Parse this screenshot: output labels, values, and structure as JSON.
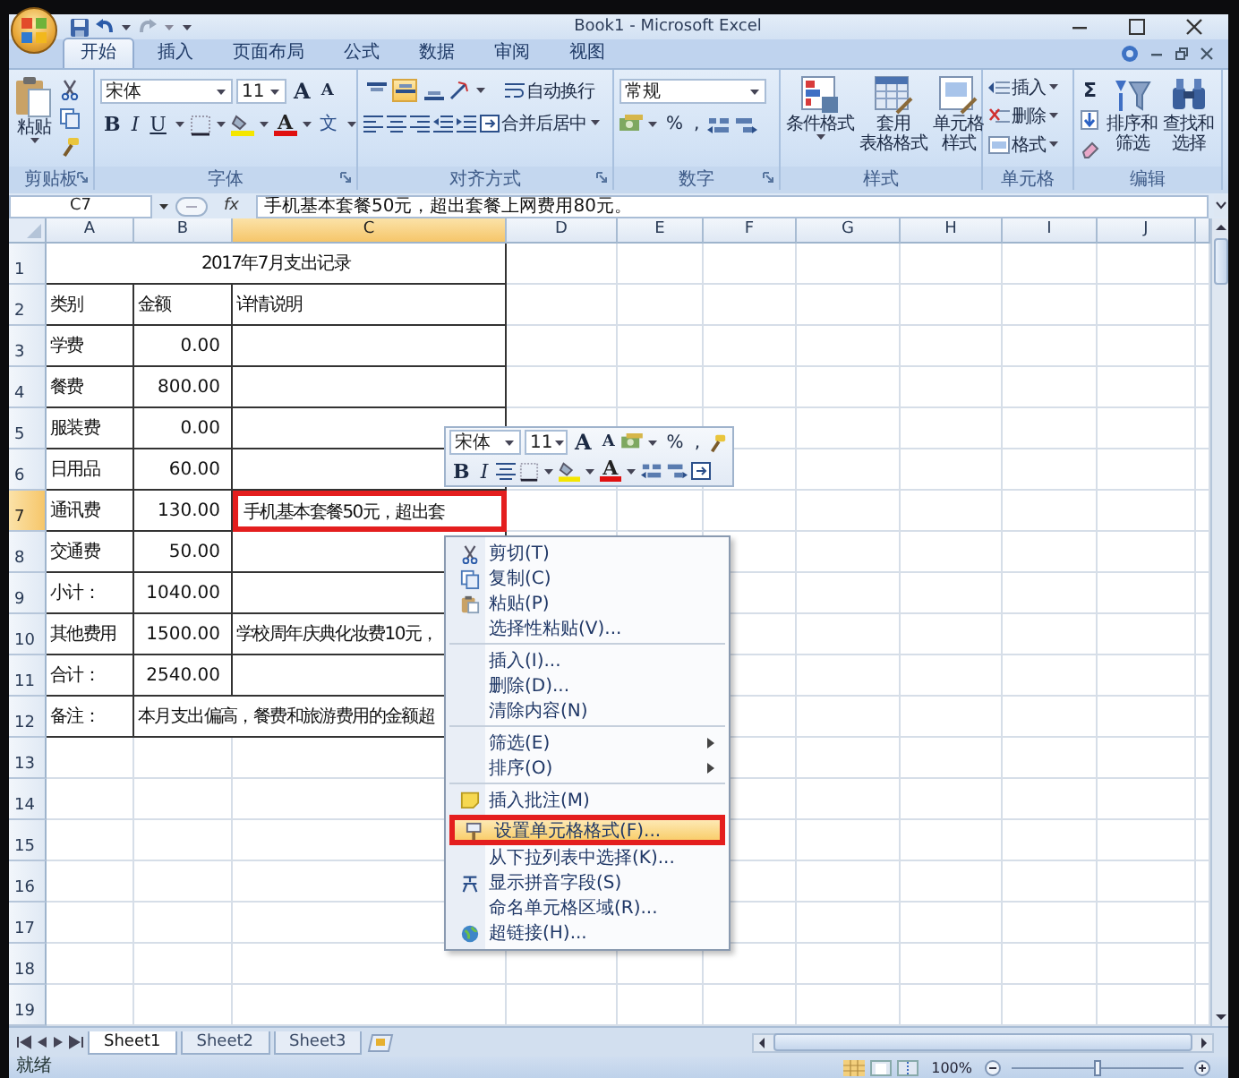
{
  "window": {
    "title": "Book1 - Microsoft Excel"
  },
  "ribbon_tabs": [
    {
      "label": "开始",
      "selected": true
    },
    {
      "label": "插入",
      "selected": false
    },
    {
      "label": "页面布局",
      "selected": false
    },
    {
      "label": "公式",
      "selected": false
    },
    {
      "label": "数据",
      "selected": false
    },
    {
      "label": "审阅",
      "selected": false
    },
    {
      "label": "视图",
      "selected": false
    }
  ],
  "ribbon": {
    "clipboard": {
      "label": "剪贴板",
      "paste": "粘贴"
    },
    "font": {
      "label": "字体",
      "font_name": "宋体",
      "font_size": "11",
      "grow_font": "A",
      "shrink_font": "A",
      "bold": "B",
      "italic": "I",
      "underline": "U",
      "font_color": "A",
      "phonetic": "文"
    },
    "alignment": {
      "label": "对齐方式",
      "vertical_align_buttons": [
        {
          "selected": false
        },
        {
          "selected": true
        },
        {
          "selected": false
        }
      ],
      "wrap_text": "自动换行",
      "merge_center": "合并后居中"
    },
    "number": {
      "label": "数字",
      "format": "常规",
      "percent": "%",
      "comma": ","
    },
    "styles": {
      "label": "样式",
      "conditional_format": [
        "条件格式"
      ],
      "table_format": [
        "套用",
        "表格格式"
      ],
      "cell_styles": [
        "单元格",
        "样式"
      ]
    },
    "cells": {
      "label": "单元格",
      "insert": "插入",
      "delete": "删除",
      "format": "格式"
    },
    "editing": {
      "label": "编辑",
      "sum": "Σ",
      "sort_filter": [
        "排序和",
        "筛选"
      ],
      "find_select": [
        "查找和",
        "选择"
      ]
    }
  },
  "formula_bar": {
    "name_box": "C7",
    "function_label": "fx",
    "content": "手机基本套餐50元，超出套餐上网费用80元。"
  },
  "columns": [
    {
      "label": "A",
      "selected": false
    },
    {
      "label": "B",
      "selected": false
    },
    {
      "label": "C",
      "selected": true
    },
    {
      "label": "D",
      "selected": false
    },
    {
      "label": "E",
      "selected": false
    },
    {
      "label": "F",
      "selected": false
    },
    {
      "label": "G",
      "selected": false
    },
    {
      "label": "H",
      "selected": false
    },
    {
      "label": "I",
      "selected": false
    },
    {
      "label": "J",
      "selected": false
    }
  ],
  "rows": [
    {
      "header": "1",
      "selected": false,
      "cells": [
        {
          "kind": "title",
          "text": "2017年7月支出记录"
        }
      ]
    },
    {
      "header": "2",
      "selected": false,
      "cells": [
        {
          "kind": "text",
          "text": "类别"
        },
        {
          "kind": "text",
          "text": "金额"
        },
        {
          "kind": "text",
          "text": "详情说明"
        }
      ]
    },
    {
      "header": "3",
      "selected": false,
      "cells": [
        {
          "kind": "text",
          "text": "学费"
        },
        {
          "kind": "number",
          "text": "0.00"
        }
      ]
    },
    {
      "header": "4",
      "selected": false,
      "cells": [
        {
          "kind": "text",
          "text": "餐费"
        },
        {
          "kind": "number",
          "text": "800.00"
        }
      ]
    },
    {
      "header": "5",
      "selected": false,
      "cells": [
        {
          "kind": "text",
          "text": "服装费"
        },
        {
          "kind": "number",
          "text": "0.00"
        }
      ]
    },
    {
      "header": "6",
      "selected": false,
      "cells": [
        {
          "kind": "text",
          "text": "日用品"
        },
        {
          "kind": "number",
          "text": "60.00"
        }
      ]
    },
    {
      "header": "7",
      "selected": true,
      "cells": [
        {
          "kind": "text",
          "text": "通讯费"
        },
        {
          "kind": "number",
          "text": "130.00"
        },
        {
          "kind": "marked",
          "text": "手机基本套餐50元，超出套"
        }
      ]
    },
    {
      "header": "8",
      "selected": false,
      "cells": [
        {
          "kind": "text",
          "text": "交通费"
        },
        {
          "kind": "number",
          "text": "50.00"
        }
      ]
    },
    {
      "header": "9",
      "selected": false,
      "cells": [
        {
          "kind": "text",
          "text": "小计："
        },
        {
          "kind": "number",
          "text": "1040.00"
        }
      ]
    },
    {
      "header": "10",
      "selected": false,
      "cells": [
        {
          "kind": "text",
          "text": "其他费用"
        },
        {
          "kind": "number",
          "text": "1500.00"
        },
        {
          "kind": "text",
          "text": "学校周年庆典化妆费10元，"
        }
      ]
    },
    {
      "header": "11",
      "selected": false,
      "cells": [
        {
          "kind": "text",
          "text": "合计："
        },
        {
          "kind": "number",
          "text": "2540.00"
        }
      ]
    },
    {
      "header": "12",
      "selected": false,
      "cells": [
        {
          "kind": "text",
          "text": "备注："
        },
        {
          "kind": "note",
          "text": "本月支出偏高，餐费和旅游费用的金额超"
        }
      ]
    },
    {
      "header": "13",
      "selected": false,
      "cells": []
    },
    {
      "header": "14",
      "selected": false,
      "cells": []
    },
    {
      "header": "15",
      "selected": false,
      "cells": []
    },
    {
      "header": "16",
      "selected": false,
      "cells": []
    },
    {
      "header": "17",
      "selected": false,
      "cells": []
    },
    {
      "header": "18",
      "selected": false,
      "cells": []
    },
    {
      "header": "19",
      "selected": false,
      "cells": []
    }
  ],
  "mini_toolbar": {
    "font_name": "宋体",
    "font_size": "11",
    "grow_font": "A",
    "shrink_font": "A",
    "percent": "%",
    "comma": ",",
    "bold": "B",
    "italic": "I",
    "font_color": "A"
  },
  "context_menu": [
    {
      "label": "剪切(T)",
      "separator_before": false,
      "submenu": false,
      "highlighted": false
    },
    {
      "label": "复制(C)",
      "separator_before": false,
      "submenu": false,
      "highlighted": false
    },
    {
      "label": "粘贴(P)",
      "separator_before": false,
      "submenu": false,
      "highlighted": false
    },
    {
      "label": "选择性粘贴(V)...",
      "separator_before": false,
      "submenu": false,
      "highlighted": false
    },
    {
      "label": "插入(I)...",
      "separator_before": true,
      "submenu": false,
      "highlighted": false
    },
    {
      "label": "删除(D)...",
      "separator_before": false,
      "submenu": false,
      "highlighted": false
    },
    {
      "label": "清除内容(N)",
      "separator_before": false,
      "submenu": false,
      "highlighted": false
    },
    {
      "label": "筛选(E)",
      "separator_before": true,
      "submenu": true,
      "highlighted": false
    },
    {
      "label": "排序(O)",
      "separator_before": false,
      "submenu": true,
      "highlighted": false
    },
    {
      "label": "插入批注(M)",
      "separator_before": true,
      "submenu": false,
      "highlighted": false
    },
    {
      "label": "设置单元格格式(F)...",
      "separator_before": true,
      "submenu": false,
      "highlighted": true
    },
    {
      "label": "从下拉列表中选择(K)...",
      "separator_before": false,
      "submenu": false,
      "highlighted": false
    },
    {
      "label": "显示拼音字段(S)",
      "separator_before": false,
      "submenu": false,
      "highlighted": false
    },
    {
      "label": "命名单元格区域(R)...",
      "separator_before": false,
      "submenu": false,
      "highlighted": false
    },
    {
      "label": "超链接(H)...",
      "separator_before": false,
      "submenu": false,
      "highlighted": false
    }
  ],
  "sheet_tabs": [
    {
      "label": "Sheet1",
      "selected": true
    },
    {
      "label": "Sheet2",
      "selected": false
    },
    {
      "label": "Sheet3",
      "selected": false
    }
  ],
  "status_bar": {
    "status": "就绪",
    "zoom": "100%",
    "zoom_slider": {
      "level": 0.5
    }
  }
}
